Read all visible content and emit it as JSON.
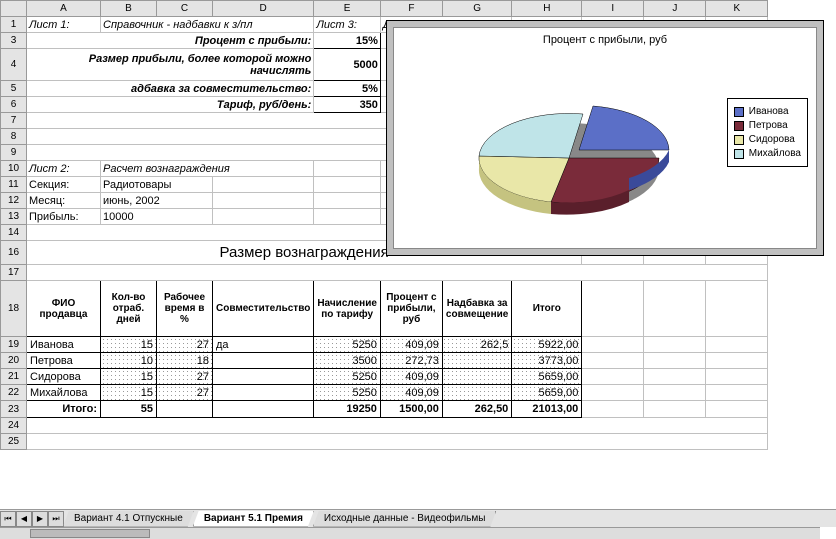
{
  "columns": [
    "A",
    "B",
    "C",
    "D",
    "E",
    "F",
    "G",
    "H",
    "I",
    "J",
    "K"
  ],
  "sheet1": {
    "label": "Лист 1:",
    "desc": "Справочник - надбавки к з/пл",
    "rows": [
      {
        "label": "Процент с прибыли:",
        "value": "15%"
      },
      {
        "label": "Размер прибыли,  более которой можно начислять",
        "value": "5000"
      },
      {
        "label": "адбавка за совместительство:",
        "value": "5%"
      },
      {
        "label": "Тариф, руб/день:",
        "value": "350"
      }
    ]
  },
  "sheet3": {
    "label": "Лист 3:",
    "desc": "Диаграмма"
  },
  "sheet2": {
    "label": "Лист 2:",
    "desc": "Расчет вознаграждения",
    "params": [
      {
        "k": "Секция:",
        "v": "Радиотовары"
      },
      {
        "k": "Месяц:",
        "v": "июнь, 2002"
      },
      {
        "k": "Прибыль:",
        "v": "10000"
      }
    ]
  },
  "table": {
    "title": "Размер вознаграждения",
    "headers": [
      "ФИО продавца",
      "Кол-во отраб. дней",
      "Рабочее время в %",
      "Совместительство",
      "Начисление по тарифу",
      "Процент с прибыли, руб",
      "Надбавка за совмещение",
      "Итого"
    ],
    "rows": [
      {
        "n": "Иванова",
        "days": "15",
        "pct": "27",
        "sov": "да",
        "tarif": "5250",
        "prib": "409,09",
        "nad": "262,5",
        "tot": "5922,00"
      },
      {
        "n": "Петрова",
        "days": "10",
        "pct": "18",
        "sov": "",
        "tarif": "3500",
        "prib": "272,73",
        "nad": "",
        "tot": "3773,00"
      },
      {
        "n": "Сидорова",
        "days": "15",
        "pct": "27",
        "sov": "",
        "tarif": "5250",
        "prib": "409,09",
        "nad": "",
        "tot": "5659,00"
      },
      {
        "n": "Михайлова",
        "days": "15",
        "pct": "27",
        "sov": "",
        "tarif": "5250",
        "prib": "409,09",
        "nad": "",
        "tot": "5659,00"
      }
    ],
    "footer": {
      "lbl": "Итого:",
      "days": "55",
      "tarif": "19250",
      "prib": "1500,00",
      "nad": "262,50",
      "tot": "21013,00"
    }
  },
  "chart_data": {
    "type": "pie",
    "title": "Процент с прибыли, руб",
    "series": [
      {
        "name": "Иванова",
        "value": 409.09,
        "color": "#5b6fc7"
      },
      {
        "name": "Петрова",
        "value": 272.73,
        "color": "#7a2b3a"
      },
      {
        "name": "Сидорова",
        "value": 409.09,
        "color": "#e9e7a8"
      },
      {
        "name": "Михайлова",
        "value": 409.09,
        "color": "#bfe4e8"
      }
    ]
  },
  "tabs": [
    {
      "label": "Вариант 4.1 Отпускные",
      "active": false
    },
    {
      "label": "Вариант 5.1 Премия",
      "active": true
    },
    {
      "label": "Исходные данные - Видеофильмы",
      "active": false
    }
  ]
}
